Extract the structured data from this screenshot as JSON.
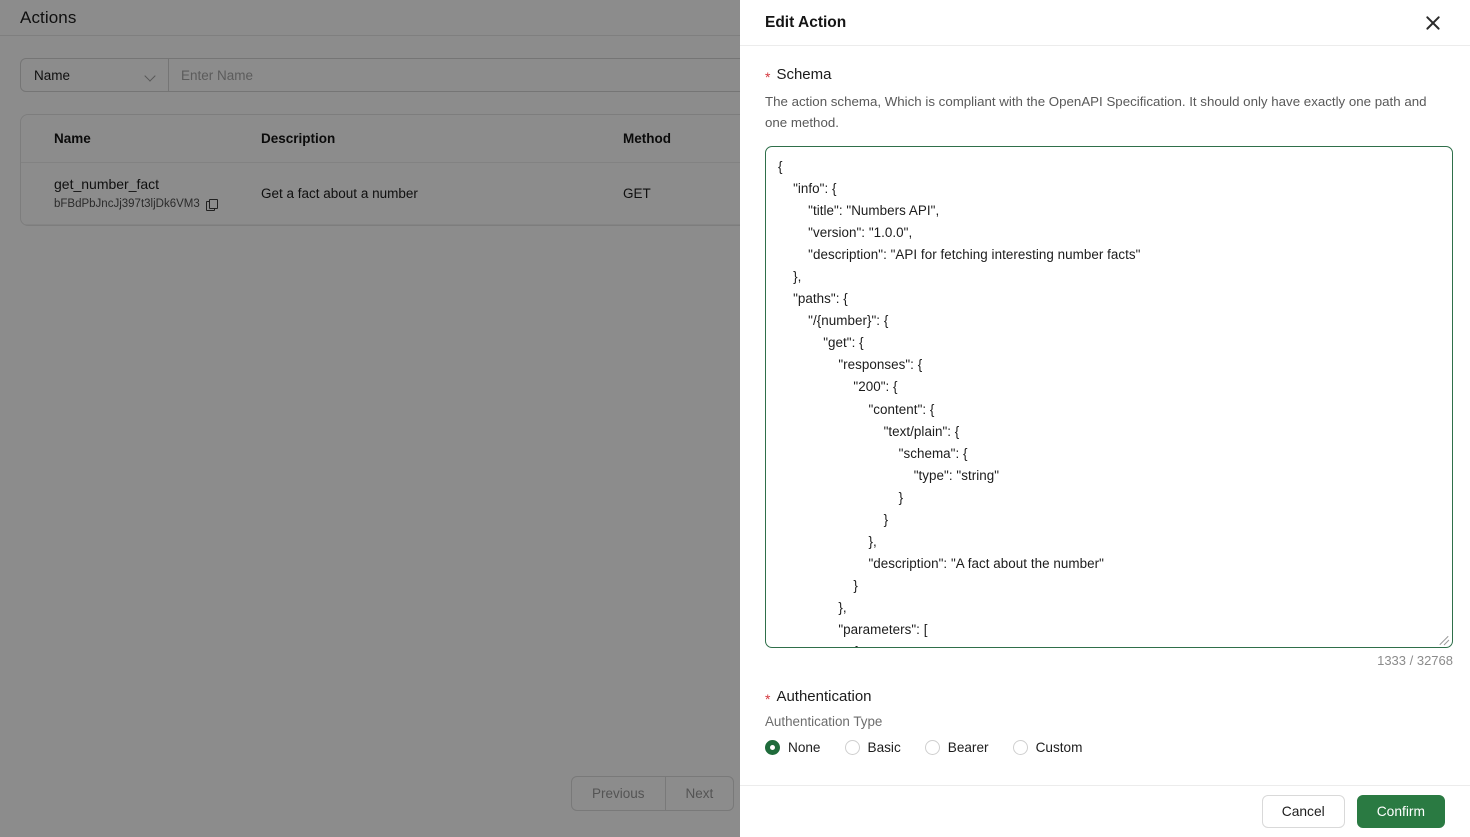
{
  "theme": {
    "accent_green": "#2a7a42",
    "required_red": "#d4383f",
    "border_grey": "#e4e4e4",
    "scrim": "rgba(0,0,0,0.45)"
  },
  "background_page": {
    "header_title": "Actions",
    "filter": {
      "select_value": "Name",
      "select_icon": "chevron-down-icon",
      "input_placeholder": "Enter Name",
      "input_value": ""
    },
    "table": {
      "columns": [
        "Name",
        "Description",
        "Method"
      ],
      "rows": [
        {
          "name": "get_number_fact",
          "id": "bFBdPbJncJj397t3ljDk6VM3",
          "copy_icon": "copy-icon",
          "description": "Get a fact about a number",
          "method": "GET"
        }
      ]
    },
    "pagination": {
      "previous_label": "Previous",
      "next_label": "Next"
    }
  },
  "drawer": {
    "title": "Edit Action",
    "close_icon": "close-icon",
    "schema": {
      "label": "Schema",
      "required_marker": "*",
      "help_text": "The action schema, Which is compliant with the OpenAPI Specification. It should only have exactly one path and one method.",
      "value": "{\n    \"info\": {\n        \"title\": \"Numbers API\",\n        \"version\": \"1.0.0\",\n        \"description\": \"API for fetching interesting number facts\"\n    },\n    \"paths\": {\n        \"/{number}\": {\n            \"get\": {\n                \"responses\": {\n                    \"200\": {\n                        \"content\": {\n                            \"text/plain\": {\n                                \"schema\": {\n                                    \"type\": \"string\"\n                                }\n                            }\n                        },\n                        \"description\": \"A fact about the number\"\n                    }\n                },\n                \"parameters\": [\n                    {",
      "char_count": "1333 / 32768",
      "char_used": 1333,
      "char_max": 32768,
      "resize_handle_icon": "resize-handle-icon"
    },
    "authentication": {
      "label": "Authentication",
      "required_marker": "*",
      "type_label": "Authentication Type",
      "selected": "None",
      "options": [
        {
          "label": "None",
          "checked": true
        },
        {
          "label": "Basic",
          "checked": false
        },
        {
          "label": "Bearer",
          "checked": false
        },
        {
          "label": "Custom",
          "checked": false
        }
      ]
    },
    "footer": {
      "cancel_label": "Cancel",
      "confirm_label": "Confirm"
    }
  }
}
